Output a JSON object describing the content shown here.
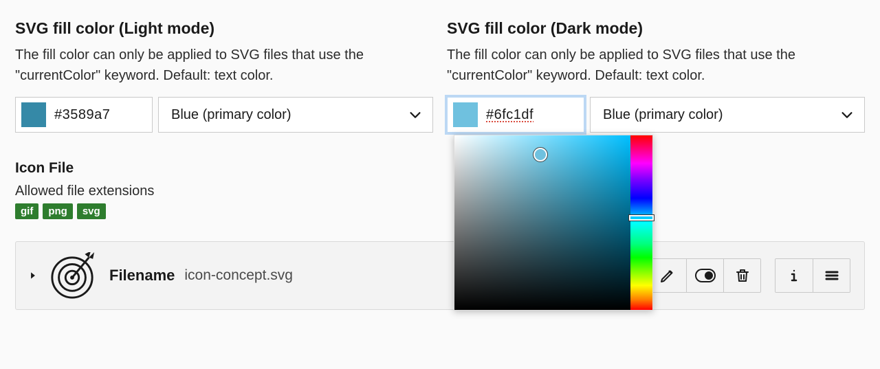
{
  "light": {
    "heading": "SVG fill color (Light mode)",
    "desc": "The fill color can only be applied to SVG files that use the \"currentColor\" keyword. Default: text color.",
    "hex": "#3589a7",
    "select_label": "Blue (primary color)",
    "swatch_hex": "#3589a7"
  },
  "dark": {
    "heading": "SVG fill color (Dark mode)",
    "desc": "The fill color can only be applied to SVG files that use the \"currentColor\" keyword. Default: text color.",
    "hex": "#6fc1df",
    "select_label": "Blue (primary color)",
    "swatch_hex": "#6fc1df"
  },
  "icon_file": {
    "heading": "Icon File",
    "allowed_label": "Allowed file extensions",
    "extensions": [
      "gif",
      "png",
      "svg"
    ],
    "filename_label": "Filename",
    "filename": "icon-concept.svg"
  },
  "picker": {
    "hue_hex": "#00bfff",
    "selected_hex": "#6fc1df"
  }
}
